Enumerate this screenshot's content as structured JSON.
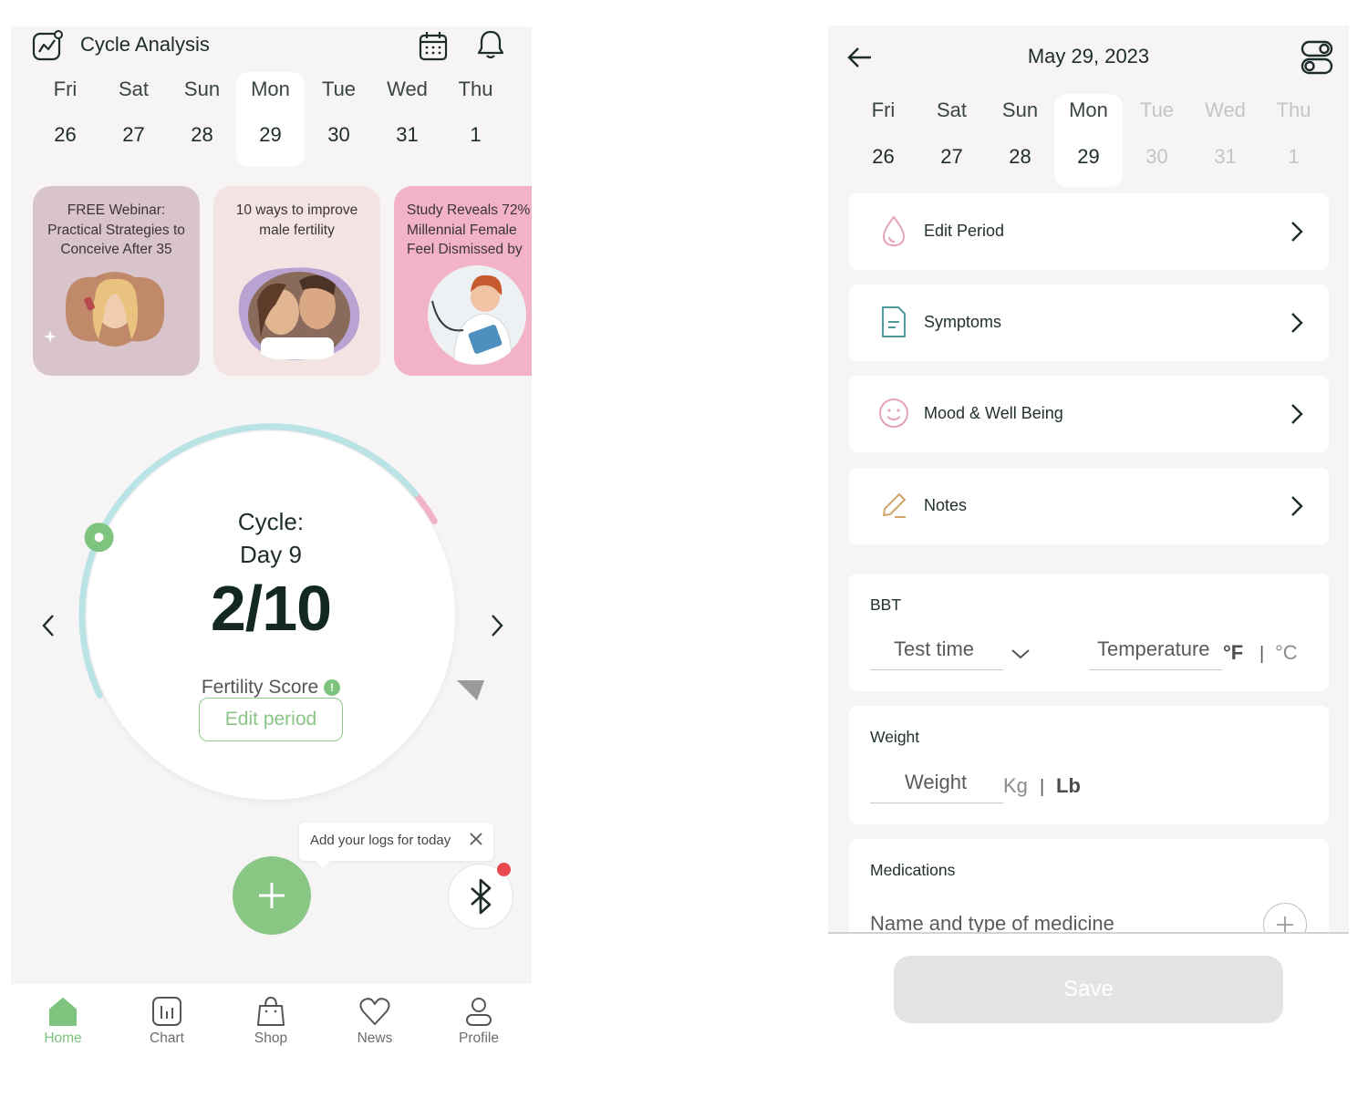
{
  "home": {
    "title": "Cycle Analysis",
    "week": [
      {
        "day": "Fri",
        "date": "26"
      },
      {
        "day": "Sat",
        "date": "27"
      },
      {
        "day": "Sun",
        "date": "28"
      },
      {
        "day": "Mon",
        "date": "29",
        "selected": true
      },
      {
        "day": "Tue",
        "date": "30"
      },
      {
        "day": "Wed",
        "date": "31"
      },
      {
        "day": "Thu",
        "date": "1"
      }
    ],
    "cards": [
      {
        "text": "FREE Webinar: Practical Strategies to Conceive After 35",
        "lines": [
          "FREE Webinar:",
          "Practical Strategies to",
          "Conceive After 35"
        ]
      },
      {
        "text": "10 ways to improve male fertility",
        "lines": [
          "10 ways to improve",
          "male fertility"
        ]
      },
      {
        "text": "Study Reveals 72% Millennial Female Feel Dismissed by",
        "lines": [
          "Study Reveals 72%",
          "Millennial Female",
          "Feel Dismissed by"
        ]
      }
    ],
    "cycle": {
      "label_line1": "Cycle:",
      "label_line2": "Day 9",
      "score": "2/10",
      "score_label": "Fertility Score",
      "info_glyph": "!",
      "edit_button": "Edit period",
      "progress_fraction": 0.3
    },
    "tooltip": "Add your logs for today",
    "tabs": [
      {
        "label": "Home",
        "icon": "home-icon",
        "active": true
      },
      {
        "label": "Chart",
        "icon": "chart-icon"
      },
      {
        "label": "Shop",
        "icon": "shopping-bag-icon"
      },
      {
        "label": "News",
        "icon": "heart-icon"
      },
      {
        "label": "Profile",
        "icon": "person-icon"
      }
    ],
    "colors": {
      "accent": "#8ac784",
      "notification": "#e8474b",
      "period_arc": "#f2b3c7",
      "cycle_arc": "#b9e3e5"
    }
  },
  "log": {
    "title": "May 29, 2023",
    "week": [
      {
        "day": "Fri",
        "date": "26"
      },
      {
        "day": "Sat",
        "date": "27"
      },
      {
        "day": "Sun",
        "date": "28"
      },
      {
        "day": "Mon",
        "date": "29",
        "selected": true
      },
      {
        "day": "Tue",
        "date": "30",
        "future": true
      },
      {
        "day": "Wed",
        "date": "31",
        "future": true
      },
      {
        "day": "Thu",
        "date": "1",
        "future": true
      }
    ],
    "rows": [
      {
        "label": "Edit Period",
        "icon": "droplet-icon"
      },
      {
        "label": "Symptoms",
        "icon": "document-icon"
      },
      {
        "label": "Mood & Well Being",
        "icon": "smiley-icon"
      },
      {
        "label": "Notes",
        "icon": "pencil-icon"
      }
    ],
    "bbt": {
      "heading": "BBT",
      "test_time_placeholder": "Test time",
      "temperature_placeholder": "Temperature",
      "unit_f": "°F",
      "unit_sep": "|",
      "unit_c": "°C"
    },
    "weight": {
      "heading": "Weight",
      "placeholder": "Weight",
      "unit_kg": "Kg",
      "unit_sep": "|",
      "unit_lb": "Lb"
    },
    "medications": {
      "heading": "Medications",
      "placeholder": "Name and type of medicine"
    },
    "save_button": "Save"
  }
}
